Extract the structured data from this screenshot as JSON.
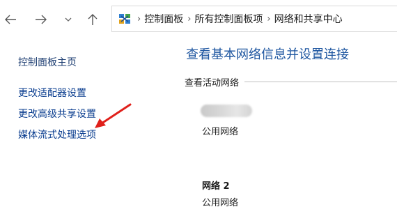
{
  "breadcrumb": {
    "items": [
      "控制面板",
      "所有控制面板项",
      "网络和共享中心"
    ],
    "separator": "›"
  },
  "nav": {
    "icons": [
      "back-arrow-icon",
      "forward-arrow-icon",
      "chevron-down-icon",
      "up-arrow-icon",
      "control-panel-icon"
    ]
  },
  "sidebar": {
    "home_label": "控制面板主页",
    "links": [
      {
        "label": "更改适配器设置"
      },
      {
        "label": "更改高级共享设置"
      },
      {
        "label": "媒体流式处理选项"
      }
    ]
  },
  "main": {
    "title": "查看基本网络信息并设置连接",
    "active_networks_label": "查看活动网络",
    "networks": [
      {
        "name": "",
        "type": "公用网络"
      },
      {
        "name": "网络 2",
        "type": "公用网络"
      }
    ]
  },
  "annotation": {
    "arrow_color": "#e0201b"
  },
  "colors": {
    "link": "#0a3d8f",
    "title": "#1e56a0"
  }
}
